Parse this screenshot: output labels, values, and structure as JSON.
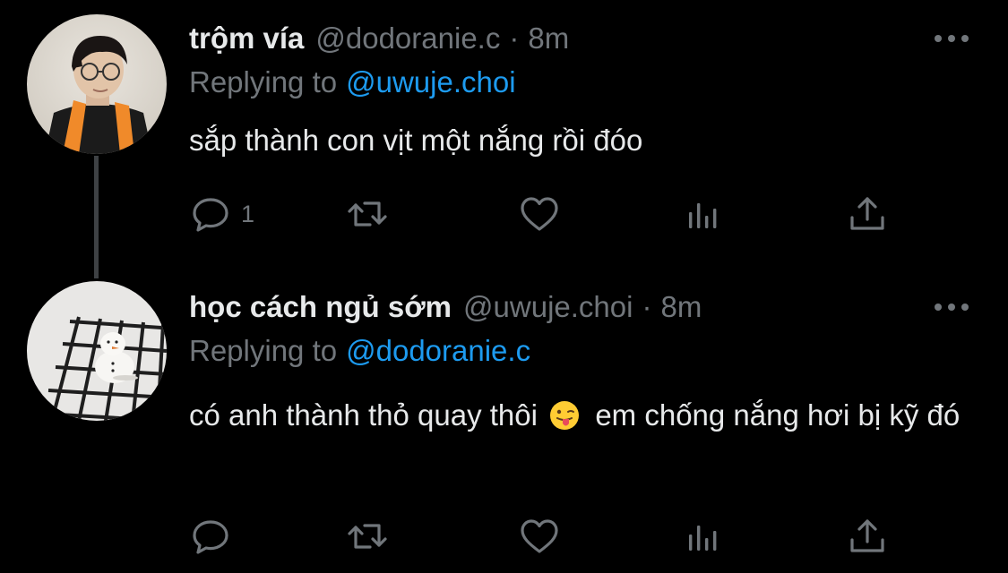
{
  "colors": {
    "background": "#000000",
    "primary_text": "#e7e9ea",
    "secondary_text": "#71767b",
    "link": "#1d9bf0",
    "thread_line": "#3e4144"
  },
  "tweets": [
    {
      "display_name": "trộm vía",
      "handle": "@dodoranie.c",
      "separator": "·",
      "time": "8m",
      "replying_label": "Replying to",
      "replying_to": "@uwuje.choi",
      "text": "sắp thành con vịt một nắng rồi đóo",
      "reply_count": "1",
      "avatar_icon": "avatar-photo-person-icon"
    },
    {
      "display_name": "học cách ngủ sớm",
      "handle": "@uwuje.choi",
      "separator": "·",
      "time": "8m",
      "replying_label": "Replying to",
      "replying_to": "@dodoranie.c",
      "text_before_emoji": "có anh thành thỏ quay thôi",
      "emoji": "tongue-out-emoji",
      "text_after_emoji": " em chống nắng hơi bị kỹ đó",
      "reply_count": "",
      "avatar_icon": "avatar-photo-snowman-icon"
    }
  ],
  "actions": {
    "reply_icon": "reply-bubble-icon",
    "retweet_icon": "retweet-icon",
    "like_icon": "heart-icon",
    "views_icon": "views-bar-chart-icon",
    "share_icon": "share-upload-icon",
    "more_icon": "more-dots-icon"
  }
}
